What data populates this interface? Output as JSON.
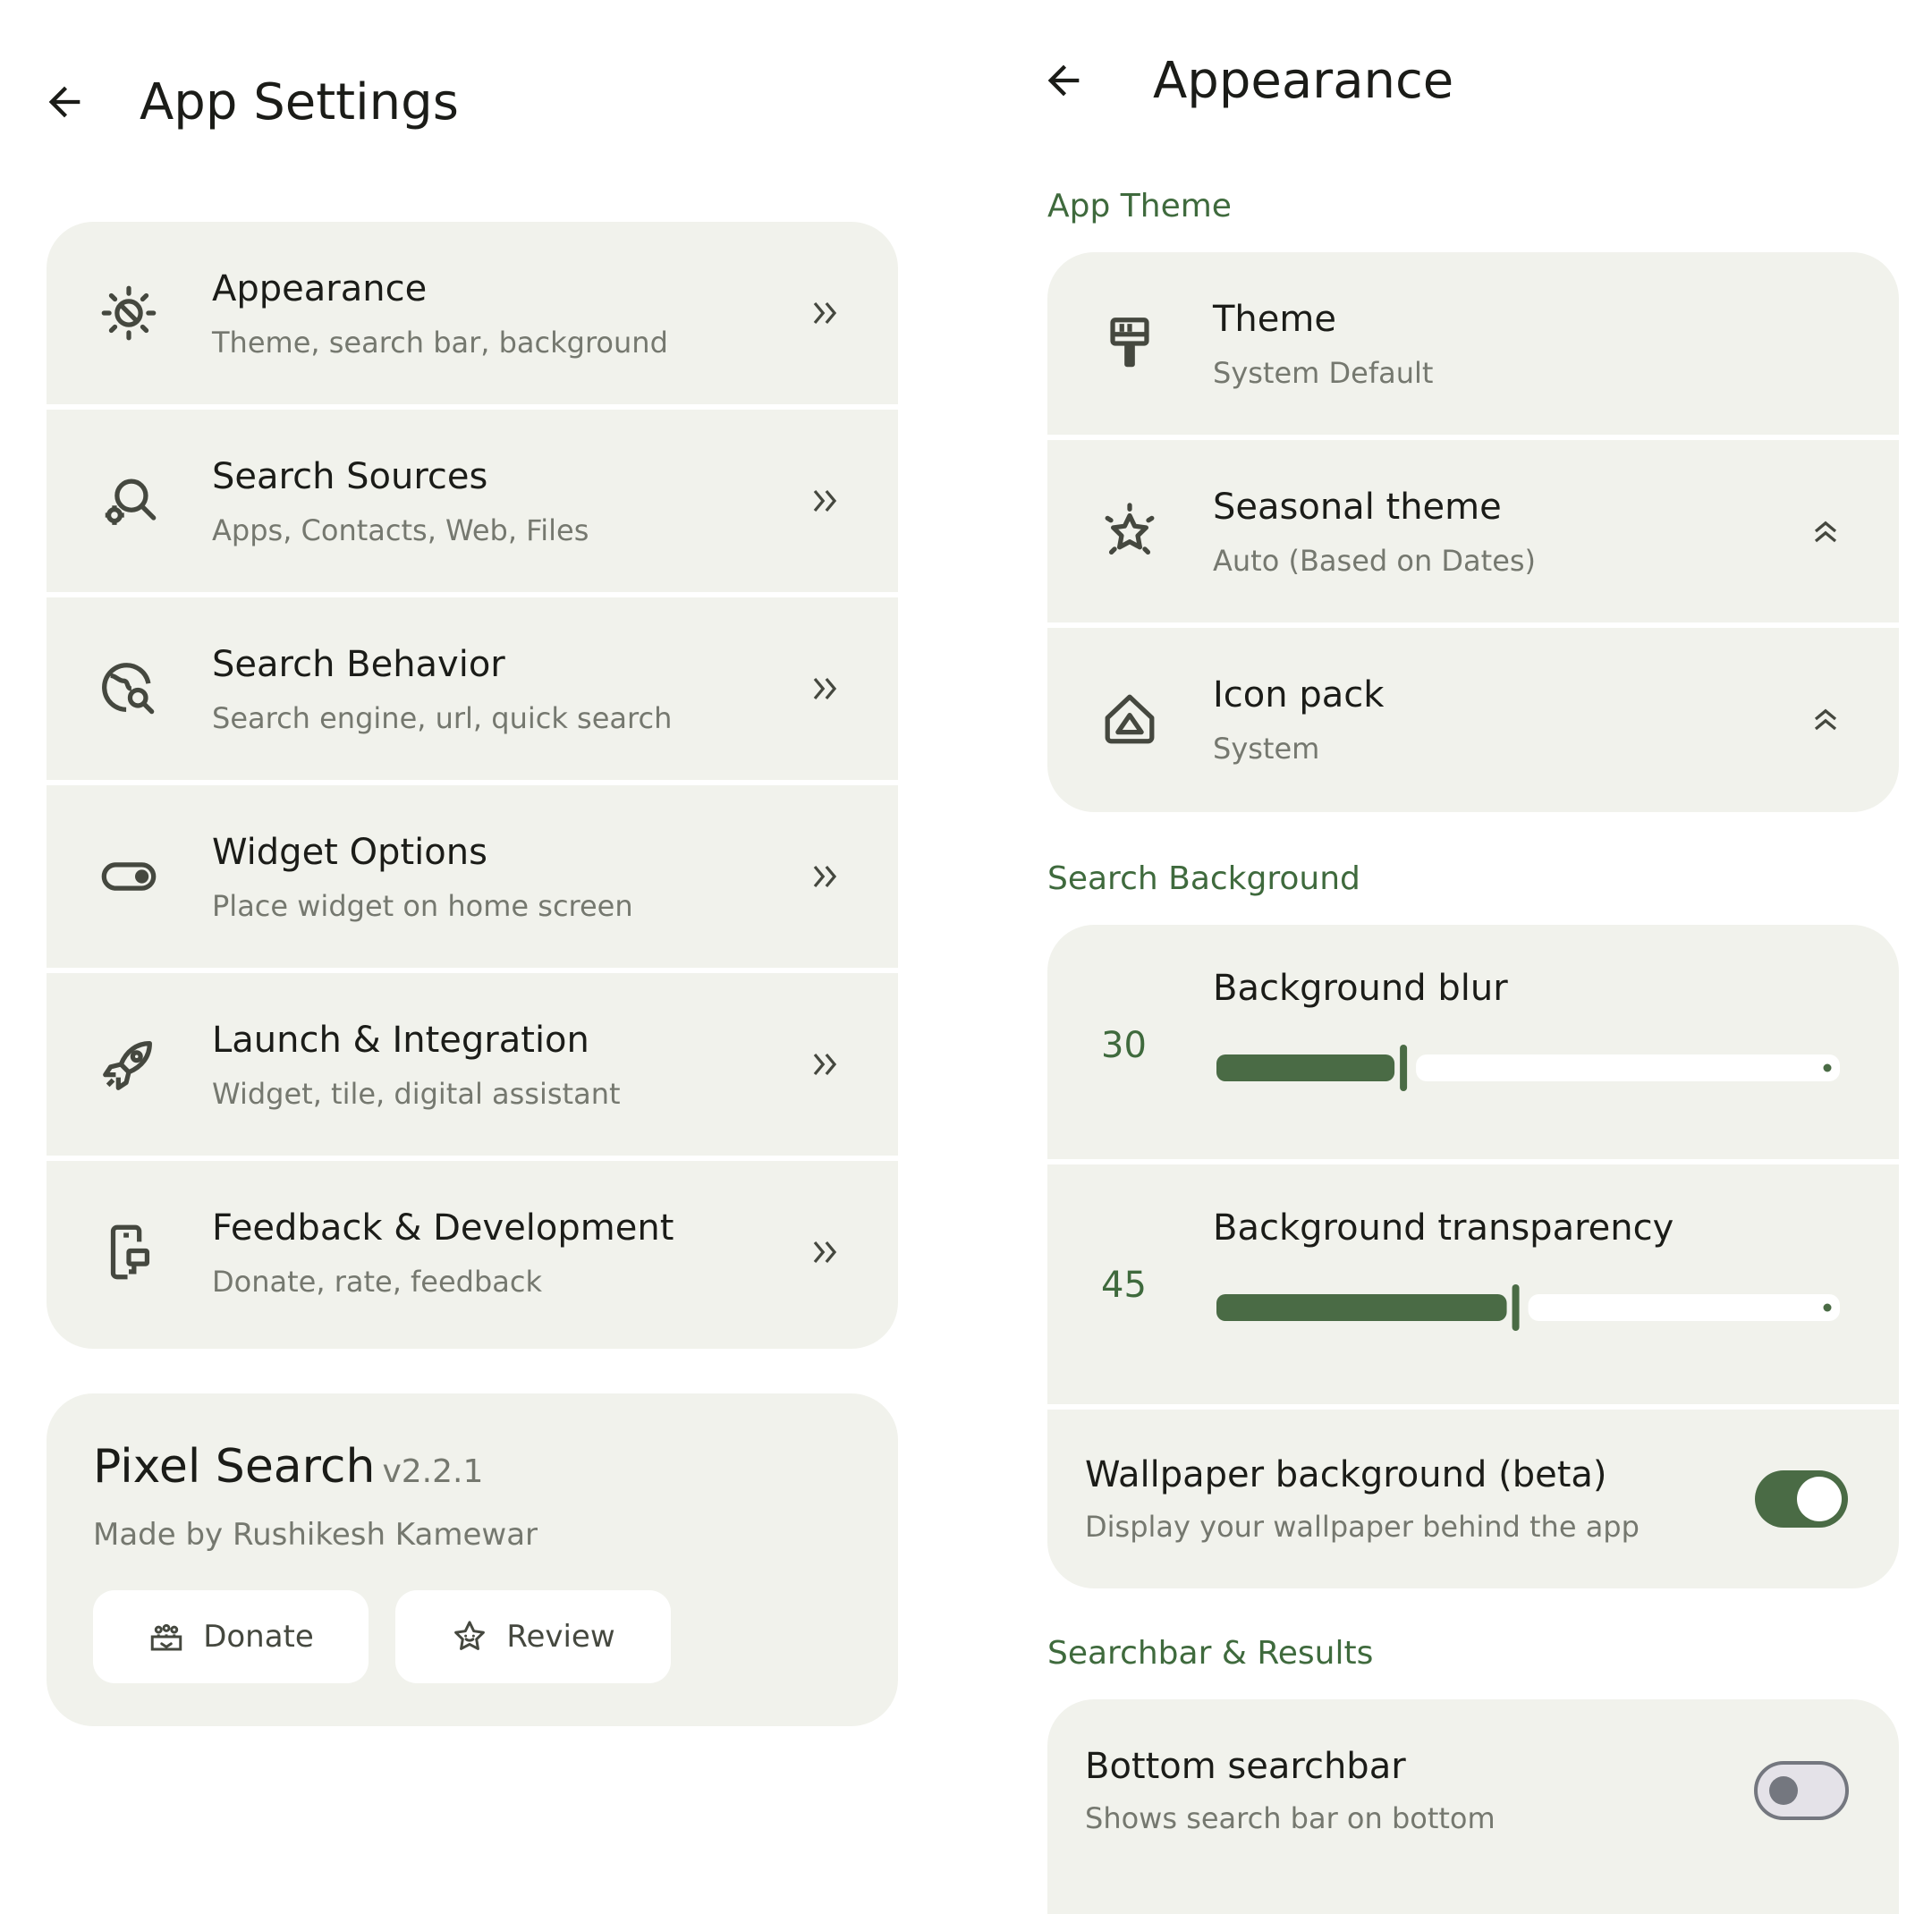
{
  "left": {
    "title": "App Settings",
    "items": [
      {
        "title": "Appearance",
        "subtitle": "Theme, search bar, background",
        "icon": "brightness-settings-icon"
      },
      {
        "title": "Search Sources",
        "subtitle": "Apps, Contacts, Web, Files",
        "icon": "manage-search-icon"
      },
      {
        "title": "Search Behavior",
        "subtitle": "Search engine, url, quick search",
        "icon": "travel-explore-icon"
      },
      {
        "title": "Widget Options",
        "subtitle": "Place widget on home screen",
        "icon": "toggle-icon"
      },
      {
        "title": "Launch & Integration",
        "subtitle": "Widget, tile, digital assistant",
        "icon": "rocket-icon"
      },
      {
        "title": "Feedback & Development",
        "subtitle": "Donate, rate, feedback",
        "icon": "device-feedback-icon"
      }
    ],
    "about": {
      "app_name": "Pixel Search",
      "version": "v2.2.1",
      "author": "Made by Rushikesh Kamewar",
      "donate_label": "Donate",
      "review_label": "Review"
    }
  },
  "right": {
    "title": "Appearance",
    "sections": {
      "app_theme": "App Theme",
      "search_background": "Search Background",
      "searchbar_results": "Searchbar & Results"
    },
    "theme": {
      "title": "Theme",
      "value": "System Default"
    },
    "seasonal": {
      "title": "Seasonal theme",
      "value": "Auto (Based on Dates)"
    },
    "icon_pack": {
      "title": "Icon pack",
      "value": "System"
    },
    "blur": {
      "title": "Background blur",
      "value": "30",
      "fraction": 0.3
    },
    "transparency": {
      "title": "Background transparency",
      "value": "45",
      "fraction": 0.48
    },
    "wallpaper": {
      "title": "Wallpaper background (beta)",
      "subtitle": "Display your wallpaper behind the app",
      "enabled": true
    },
    "bottom_searchbar": {
      "title": "Bottom searchbar",
      "subtitle": "Shows search bar on bottom",
      "enabled": false
    }
  },
  "colors": {
    "accent": "#4a6b45",
    "card": "#f1f2ec",
    "text": "#1b1c18",
    "subtext": "#75786f"
  }
}
